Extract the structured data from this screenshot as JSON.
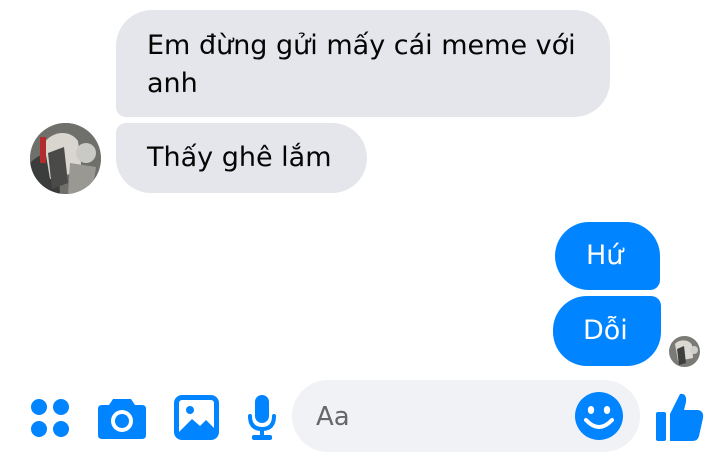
{
  "conversation": {
    "messages": [
      {
        "from": "them",
        "text": "Em đừng gửi mấy cái meme với anh"
      },
      {
        "from": "them",
        "text": "Thấy ghê lắm"
      },
      {
        "from": "me",
        "text": "Hứ"
      },
      {
        "from": "me",
        "text": "Dỗi"
      }
    ]
  },
  "composer": {
    "placeholder": "Aa",
    "icons": [
      "apps-icon",
      "camera-icon",
      "image-icon",
      "microphone-icon",
      "emoji-icon",
      "like-icon"
    ]
  },
  "colors": {
    "accent": "#0084ff",
    "incoming_bubble": "#e4e6eb",
    "composer_bg": "#f0f2f5",
    "placeholder_text": "#65676b"
  }
}
